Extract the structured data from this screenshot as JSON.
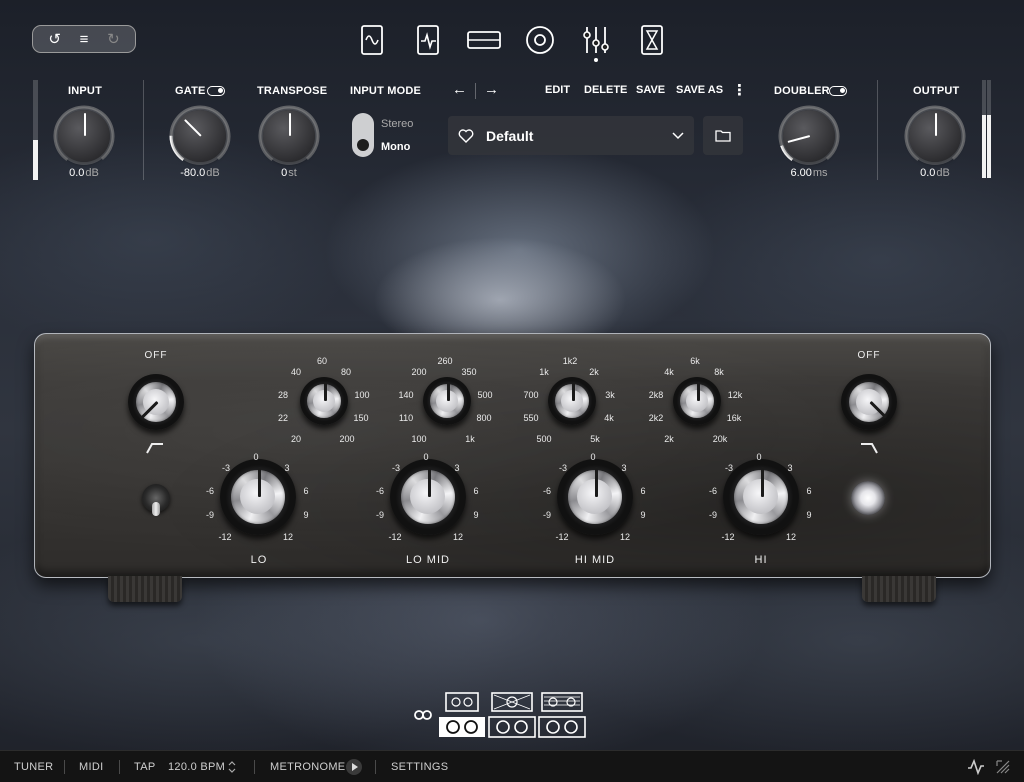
{
  "nav": {
    "history_icons": [
      "undo-icon",
      "menu-icon",
      "redo-icon"
    ],
    "tabs": [
      "waveform-icon",
      "pedal-icon",
      "rack-icon",
      "speaker-icon",
      "mixer-icon",
      "hourglass-icon"
    ],
    "active_tab": "mixer-icon"
  },
  "header": {
    "input": {
      "label": "INPUT",
      "value": "0.0",
      "unit": "dB",
      "meter_level": 0.4
    },
    "gate": {
      "label": "GATE",
      "value": "-80.0",
      "unit": "dB",
      "enabled": true
    },
    "transpose": {
      "label": "TRANSPOSE",
      "value": "0",
      "unit": "st"
    },
    "input_mode": {
      "label": "INPUT MODE",
      "option_top": "Stereo",
      "option_bottom": "Mono",
      "selected": "Mono"
    },
    "preset": {
      "prev": "←",
      "next": "→",
      "edit": "EDIT",
      "delete": "DELETE",
      "save": "SAVE",
      "save_as": "SAVE AS",
      "more": "⋮",
      "name": "Default",
      "chevron": "⌄"
    },
    "doubler": {
      "label": "DOUBLER",
      "value": "6.00",
      "unit": "ms",
      "enabled": true
    },
    "output": {
      "label": "OUTPUT",
      "value": "0.0",
      "unit": "dB",
      "meter_level": 0.64
    }
  },
  "eq": {
    "left_off": "OFF",
    "right_off": "OFF",
    "lo_freq_labels": [
      "20",
      "22",
      "28",
      "40",
      "60",
      "80",
      "100",
      "150",
      "200"
    ],
    "lomid_freq_labels": [
      "100",
      "110",
      "140",
      "200",
      "260",
      "350",
      "500",
      "800",
      "1k"
    ],
    "himid_freq_labels": [
      "500",
      "550",
      "700",
      "1k",
      "1k2",
      "2k",
      "3k",
      "4k",
      "5k"
    ],
    "hi_freq_labels": [
      "2k",
      "2k2",
      "2k8",
      "4k",
      "6k",
      "8k",
      "12k",
      "16k",
      "20k"
    ],
    "gain_labels": [
      "-12",
      "-9",
      "-6",
      "-3",
      "0",
      "3",
      "6",
      "9",
      "12"
    ],
    "bands": [
      "LO",
      "LO MID",
      "HI MID",
      "HI"
    ]
  },
  "cabinets": {
    "selected_index": 0
  },
  "status": {
    "tuner": "TUNER",
    "midi": "MIDI",
    "tap": "TAP",
    "bpm": "120.0 BPM",
    "metronome": "METRONOME",
    "settings": "SETTINGS"
  }
}
